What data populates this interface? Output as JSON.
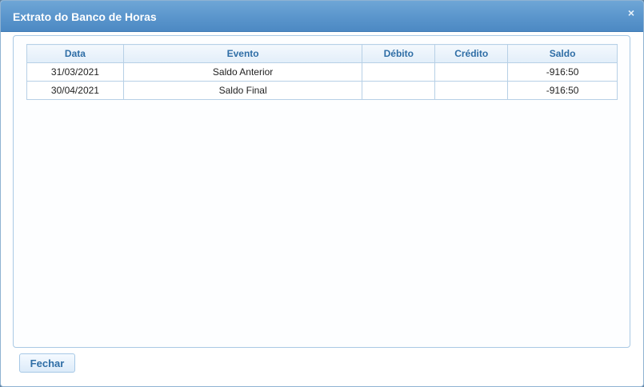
{
  "dialog": {
    "title": "Extrato do Banco de Horas",
    "close_icon": "×"
  },
  "table": {
    "columns": [
      "Data",
      "Evento",
      "Débito",
      "Crédito",
      "Saldo"
    ],
    "rows": [
      {
        "data": "31/03/2021",
        "evento": "Saldo Anterior",
        "debito": "",
        "credito": "",
        "saldo": "-916:50"
      },
      {
        "data": "30/04/2021",
        "evento": "Saldo Final",
        "debito": "",
        "credito": "",
        "saldo": "-916:50"
      }
    ]
  },
  "footer": {
    "fechar_label": "Fechar"
  }
}
